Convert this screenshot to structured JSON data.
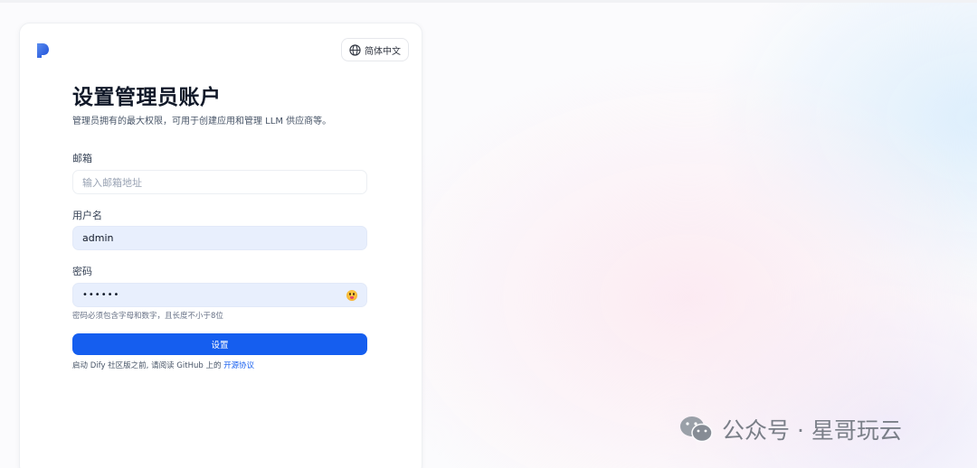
{
  "language_button": {
    "label": "简体中文",
    "icon": "globe-icon"
  },
  "logo": {
    "icon": "dify-logo-icon",
    "color": "#1d4ed8"
  },
  "header": {
    "title": "设置管理员账户",
    "subtitle": "管理员拥有的最大权限，可用于创建应用和管理 LLM 供应商等。"
  },
  "form": {
    "email": {
      "label": "邮箱",
      "value": "",
      "placeholder": "输入邮箱地址"
    },
    "username": {
      "label": "用户名",
      "value": "admin"
    },
    "password": {
      "label": "密码",
      "value": "••••••",
      "toggle_icon": "emoji-eye-icon",
      "hint": "密码必须包含字母和数字，且长度不小于8位"
    },
    "submit_label": "设置"
  },
  "notice": {
    "text": "启动 Dify 社区版之前, 请阅读 GitHub 上的 ",
    "link_label": "开源协议"
  },
  "watermark": {
    "icon": "wechat-icon",
    "text": "公众号 · 星哥玩云"
  },
  "colors": {
    "primary": "#155eef",
    "filled_input": "#e8effd"
  }
}
